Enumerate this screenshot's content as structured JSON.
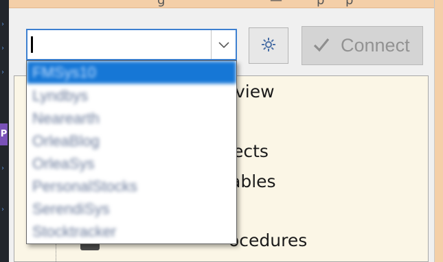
{
  "left_strip": {
    "badge_text": "P",
    "marks": [
      "›",
      "›",
      "›",
      "›",
      "›"
    ]
  },
  "title_ghost": [
    "g",
    "—",
    "p",
    "p"
  ],
  "connection_bar": {
    "combo_value": "",
    "connect_label": "Connect",
    "icons": {
      "dropdown": "chevron-down-icon",
      "settings": "gear-icon",
      "connect": "checkmark-icon"
    }
  },
  "tree": {
    "visible_fragments": [
      "view",
      "ects",
      "ables",
      "ocedures"
    ]
  },
  "dropdown": {
    "items": [
      {
        "label": "FMSys10",
        "selected": true
      },
      {
        "label": "Lyndbys",
        "selected": false
      },
      {
        "label": "Nearearth",
        "selected": false
      },
      {
        "label": "OrleaBlog",
        "selected": false
      },
      {
        "label": "OrleaSys",
        "selected": false
      },
      {
        "label": "PersonalStocks",
        "selected": false
      },
      {
        "label": "SerendiSys",
        "selected": false
      },
      {
        "label": "Stocktracker",
        "selected": false
      }
    ]
  },
  "colors": {
    "accent": "#1677d6",
    "panel_bg": "#fbf6e6",
    "frame": "#f4cfa8"
  }
}
